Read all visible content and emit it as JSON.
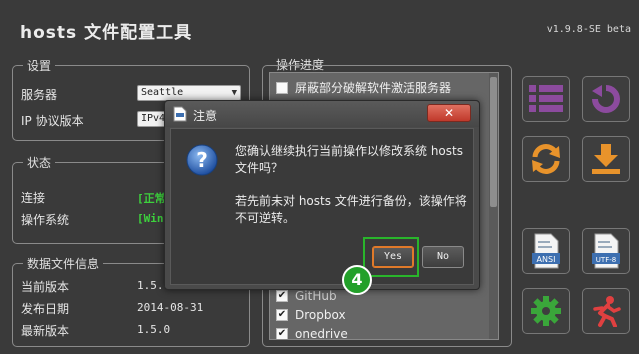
{
  "app": {
    "title": "hosts 文件配置工具",
    "version": "v1.9.8-SE beta"
  },
  "settings": {
    "legend": "设置",
    "server_label": "服务器",
    "server_value": "Seattle",
    "ip_label": "IP 协议版本",
    "ip_value": "IPv4"
  },
  "status": {
    "legend": "状态",
    "connection_label": "连接",
    "connection_value": "[正常",
    "os_label": "操作系统",
    "os_value": "[Win"
  },
  "datafile": {
    "legend": "数据文件信息",
    "current_label": "当前版本",
    "current_value": "1.5.0",
    "release_label": "发布日期",
    "release_value": "2014-08-31",
    "latest_label": "最新版本",
    "latest_value": "1.5.0"
  },
  "progress": {
    "legend": "操作进度",
    "items": [
      {
        "label": "屏蔽部分破解软件激活服务器",
        "checked": false
      },
      {
        "label": "GitHub",
        "checked": true
      },
      {
        "label": "Dropbox",
        "checked": true
      },
      {
        "label": "onedrive",
        "checked": true
      }
    ]
  },
  "toolbar": {
    "buttons": [
      {
        "name": "list-icon",
        "color": "#8c4b9e"
      },
      {
        "name": "refresh-icon",
        "color": "#8c4b9e"
      },
      {
        "name": "sync-icon",
        "color": "#e8932b"
      },
      {
        "name": "download-icon",
        "color": "#e8932b"
      },
      {
        "name": "ansi-file-icon",
        "label": "ANSI"
      },
      {
        "name": "utf8-file-icon",
        "label": "UTF-8"
      },
      {
        "name": "gear-icon",
        "color": "#3aa63a"
      },
      {
        "name": "run-icon",
        "color": "#e04040"
      }
    ]
  },
  "dialog": {
    "title": "注意",
    "close_label": "✕",
    "message_line1": "您确认继续执行当前操作以修改系统 hosts",
    "message_line2": "文件吗？",
    "message_line3": "若先前未对 hosts 文件进行备份，该操作将",
    "message_line4": "不可逆转。",
    "yes_label": "Yes",
    "no_label": "No"
  },
  "annotation": {
    "step": "4"
  },
  "colors": {
    "accent_green": "#29b52b",
    "close_red": "#c0392b",
    "focus_orange": "#e07a2a"
  }
}
